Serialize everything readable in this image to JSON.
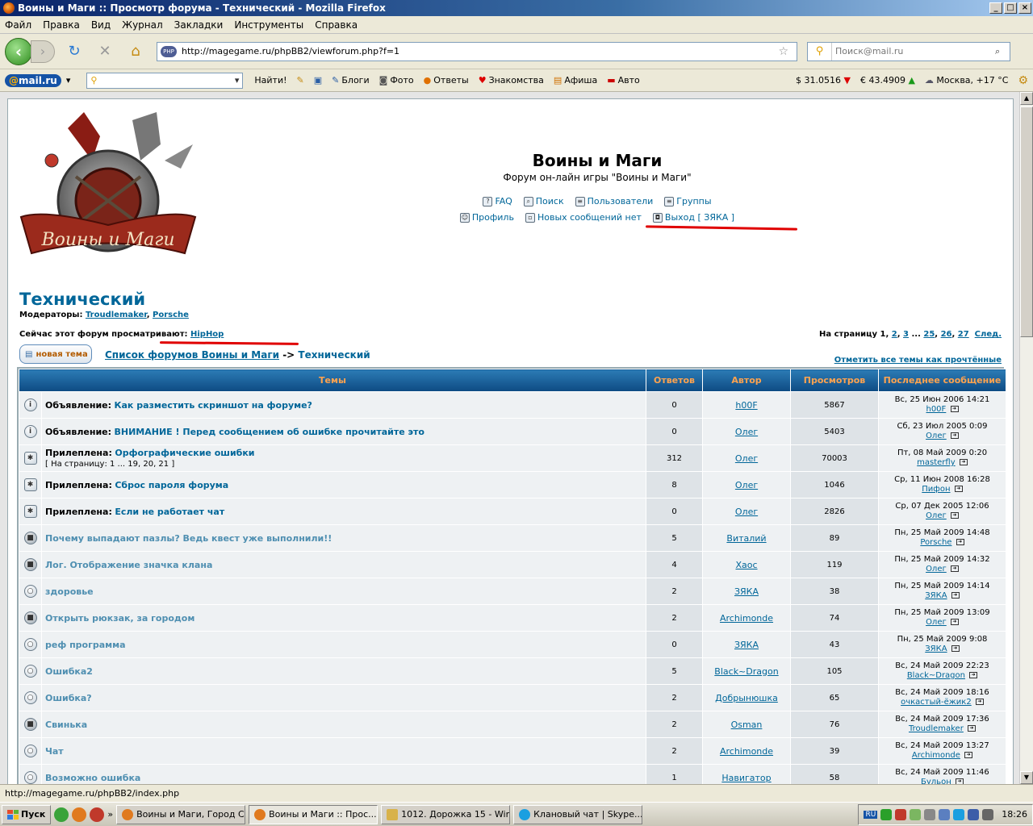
{
  "window": {
    "title": "Воины и Маги :: Просмотр форума - Технический - Mozilla Firefox",
    "controls": [
      "_",
      "□",
      "×"
    ]
  },
  "menu": [
    "Файл",
    "Правка",
    "Вид",
    "Журнал",
    "Закладки",
    "Инструменты",
    "Справка"
  ],
  "nav": {
    "url": "http://magegame.ru/phpBB2/viewforum.php?f=1",
    "url_badge": "PHP",
    "search_placeholder": "Поиск@mail.ru"
  },
  "mailbar": {
    "logo_at": "@",
    "logo_text": "mail.ru",
    "find_button": "Найти!",
    "links": [
      "Блоги",
      "Фото",
      "Ответы",
      "Знакомства",
      "Афиша",
      "Авто"
    ],
    "usd": "$ 31.0516",
    "eur": "€ 43.4909",
    "weather": "Москва, +17 °C"
  },
  "forum": {
    "site_title": "Воины и Маги",
    "site_desc": "Форум он-лайн игры \"Воины и Маги\"",
    "links_row1": [
      "FAQ",
      "Поиск",
      "Пользователи",
      "Группы"
    ],
    "links_row2": [
      "Профиль",
      "Новых сообщений нет",
      "Выход [ ЗЯКА ]"
    ],
    "forum_name": "Технический",
    "moderators_label": "Модераторы:",
    "moderators": [
      "Troudlemaker",
      "Porsche"
    ],
    "viewers_label": "Сейчас этот форум просматривают:",
    "viewers": "HipHop",
    "pagination_label": "На страницу",
    "pages": [
      "1",
      "2",
      "3",
      "25",
      "26",
      "27"
    ],
    "next": "След.",
    "new_topic": "новая тема",
    "breadcrumb_home": "Список форумов Воины и Маги",
    "breadcrumb_sep": "->",
    "breadcrumb_current": "Технический",
    "mark_read": "Отметить все темы как прочтённые"
  },
  "table": {
    "headers": [
      "Темы",
      "Ответов",
      "Автор",
      "Просмотров",
      "Последнее сообщение"
    ],
    "rows": [
      {
        "icon": "i",
        "prefix": "Объявление:",
        "title": "Как разместить скриншот на форуме?",
        "replies": "0",
        "author": "h00F",
        "views": "5867",
        "last_date": "Вс, 25 Июн 2006 14:21",
        "last_user": "h00F"
      },
      {
        "icon": "i",
        "prefix": "Объявление:",
        "title": "ВНИМАНИЕ ! Перед сообщением об ошибке прочитайте это",
        "replies": "0",
        "author": "Олег",
        "views": "5403",
        "last_date": "Сб, 23 Июл 2005 0:09",
        "last_user": "Олег"
      },
      {
        "icon": "s",
        "prefix": "Прилеплена:",
        "title": "Орфографические ошибки",
        "pages": "[ На страницу: 1 ... 19, 20, 21 ]",
        "replies": "312",
        "author": "Олег",
        "views": "70003",
        "last_date": "Пт, 08 Май 2009 0:20",
        "last_user": "masterfly"
      },
      {
        "icon": "s",
        "prefix": "Прилеплена:",
        "title": "Сброс пароля форума",
        "replies": "8",
        "author": "Олег",
        "views": "1046",
        "last_date": "Ср, 11 Июн 2008 16:28",
        "last_user": "Пифон"
      },
      {
        "icon": "s",
        "prefix": "Прилеплена:",
        "title": "Если не работает чат",
        "replies": "0",
        "author": "Олег",
        "views": "2826",
        "last_date": "Ср, 07 Дек 2005 12:06",
        "last_user": "Олег"
      },
      {
        "icon": "l",
        "prefix": "",
        "title": "Почему выпадают пазлы? Ведь квест уже выполнили!!",
        "replies": "5",
        "author": "Виталий",
        "views": "89",
        "last_date": "Пн, 25 Май 2009 14:48",
        "last_user": "Porsche"
      },
      {
        "icon": "l",
        "prefix": "",
        "title": "Лог. Отображение значка клана",
        "replies": "4",
        "author": "Хаос",
        "views": "119",
        "last_date": "Пн, 25 Май 2009 14:32",
        "last_user": "Олег"
      },
      {
        "icon": "n",
        "prefix": "",
        "title": "здоровье",
        "replies": "2",
        "author": "ЗЯКА",
        "views": "38",
        "last_date": "Пн, 25 Май 2009 14:14",
        "last_user": "ЗЯКА"
      },
      {
        "icon": "l",
        "prefix": "",
        "title": "Открыть рюкзак, за городом",
        "replies": "2",
        "author": "Archimonde",
        "views": "74",
        "last_date": "Пн, 25 Май 2009 13:09",
        "last_user": "Олег"
      },
      {
        "icon": "n",
        "prefix": "",
        "title": "реф программа",
        "replies": "0",
        "author": "ЗЯКА",
        "views": "43",
        "last_date": "Пн, 25 Май 2009 9:08",
        "last_user": "ЗЯКА"
      },
      {
        "icon": "n",
        "prefix": "",
        "title": "Ошибка2",
        "replies": "5",
        "author": "Black~Dragon",
        "views": "105",
        "last_date": "Вс, 24 Май 2009 22:23",
        "last_user": "Black~Dragon"
      },
      {
        "icon": "n",
        "prefix": "",
        "title": "Ошибка?",
        "replies": "2",
        "author": "Добрынюшка",
        "views": "65",
        "last_date": "Вс, 24 Май 2009 18:16",
        "last_user": "очкастый-ёжик2"
      },
      {
        "icon": "l",
        "prefix": "",
        "title": "Свинька",
        "replies": "2",
        "author": "Osman",
        "views": "76",
        "last_date": "Вс, 24 Май 2009 17:36",
        "last_user": "Troudlemaker"
      },
      {
        "icon": "n",
        "prefix": "",
        "title": "Чат",
        "replies": "2",
        "author": "Archimonde",
        "views": "39",
        "last_date": "Вс, 24 Май 2009 13:27",
        "last_user": "Archimonde"
      },
      {
        "icon": "n",
        "prefix": "",
        "title": "Возможно ошибка",
        "replies": "1",
        "author": "Навигатор",
        "views": "58",
        "last_date": "Вс, 24 Май 2009 11:46",
        "last_user": "Бульон"
      }
    ]
  },
  "status": "http://magegame.ru/phpBB2/index.php",
  "taskbar": {
    "start": "Пуск",
    "tasks": [
      "Воины и Маги, Город С...",
      "Воины и Маги :: Прос...",
      "1012. Дорожка 15 - Win...",
      "Клановый чат | Skype..."
    ],
    "lang": "RU",
    "clock": "18:26"
  }
}
